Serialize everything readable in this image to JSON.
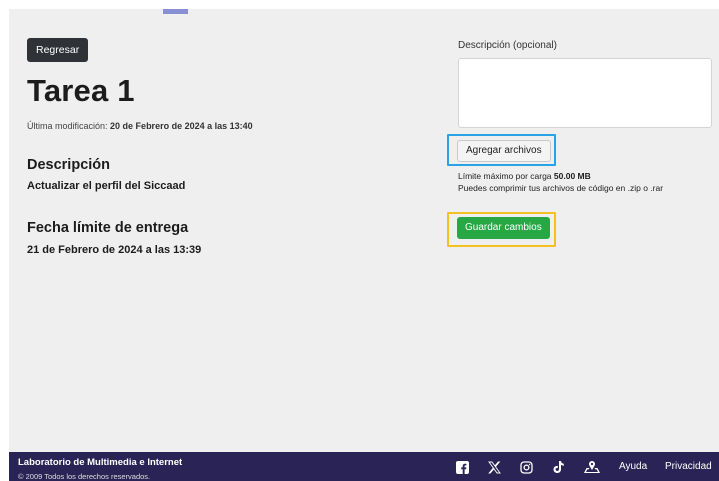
{
  "header": {
    "back_label": "Regresar",
    "title": "Tarea 1",
    "modified_label": "Última modificación:",
    "modified_value": "20 de Febrero de 2024 a las 13:40"
  },
  "description": {
    "heading": "Descripción",
    "value": "Actualizar el perfil del Siccaad"
  },
  "deadline": {
    "heading": "Fecha límite de entrega",
    "value": "21 de Febrero de 2024 a las 13:39"
  },
  "form": {
    "desc_label": "Descripción (opcional)",
    "desc_value": "",
    "attach_label": "Agregar archivos",
    "limit_prefix": "Límite máximo por carga",
    "limit_value": "50.00 MB",
    "compress_hint": "Puedes comprimir tus archivos de código en .zip o .rar",
    "save_label": "Guardar cambios"
  },
  "footer": {
    "org": "Laboratorio de Multimedia e Internet",
    "copyright": "© 2009 Todos los derechos reservados.",
    "icons": [
      "facebook-icon",
      "x-icon",
      "instagram-icon",
      "tiktok-icon",
      "map-people-icon"
    ],
    "links": [
      "Ayuda",
      "Privacidad"
    ]
  },
  "colors": {
    "footer_bg": "#2a2456",
    "save_green": "#28a745",
    "highlight_blue": "#2aa3e6",
    "highlight_yellow": "#f3c220"
  }
}
